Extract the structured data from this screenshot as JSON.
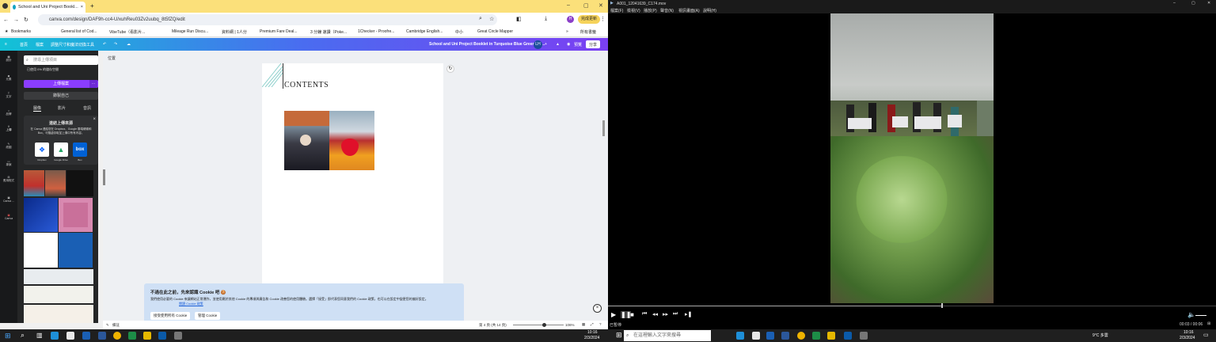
{
  "browser": {
    "tab_title": "School and Uni Project Bookl...",
    "url": "canva.com/design/DAF9h-cc4-U/xuhReu03Zv2uubq_8t5fZQ/edit",
    "update_button": "完成更新",
    "bookmarks_label": "Bookmarks",
    "all_bookmarks": "所有書籤",
    "bookmarks": [
      "General list of Cod...",
      "VibeTube（看影片...",
      "Mileage Run Discu...",
      "資料網 | 1人分",
      "Premium Fare Deal...",
      "3 分鐘 速讀（Poke...",
      "1Checker - Proofre...",
      "Cambridge English...",
      "中小",
      "Great Circle Mapper"
    ],
    "profile_initial": "H"
  },
  "canva": {
    "home": "首頁",
    "file": "檔案",
    "resize": "調整尺寸和魔法切換工具",
    "doc_title": "School and Uni Project Booklet in Turquoise Blue Green Viv...",
    "avatar": "LH",
    "preview": "預覽",
    "share": "分享",
    "position": "位置",
    "rail": [
      "設計",
      "元素",
      "文字",
      "品牌",
      "上傳",
      "繪圖",
      "專案",
      "應用程式",
      "Canva ...",
      "Canva"
    ],
    "search_placeholder": "搜尋上傳項目",
    "storage_text": "已使用 0% 的儲存空間",
    "upload_button": "上傳檔案",
    "record_button": "錄製自己",
    "panel_tabs": [
      "圖像",
      "影片",
      "音訊"
    ],
    "connect_title": "連結上傳來源",
    "connect_desc": "在 Canva 連結您在 Dropbox、Google 雲端硬碟和 Box，可隨處存取並上傳中所有內容。",
    "sources": [
      "Dropbox",
      "Google Drive",
      "Box"
    ],
    "page_heading": "CONTENTS",
    "page_indicator": "第 4 頁 (共 14 頁)",
    "zoom": "106%",
    "notes": "備註"
  },
  "cookie": {
    "title": "不過在此之前，先來認識 Cookie 吧 🍪",
    "body": "我們使用必要的 Cookie 來讓網站正常運作，並使用屬於其他 Cookie 的專項與廣告和 Cookie 改善您的使用體驗。選擇「接受」即代表您同意我們的 Cookie 政策，也可以在設定中變更您的偏好設定。",
    "link": "閱讀 Cookie 政策",
    "accept": "接受使用所有 Cookie",
    "manage": "管理 Cookie"
  },
  "player": {
    "title": "A001_12041639_C174.mov",
    "menu": [
      "檔案(F)",
      "檢視(V)",
      "播放(P)",
      "聲音(N)",
      "視訊畫面(A)",
      "說明(H)"
    ],
    "status": "已暫停",
    "time": "00:03 / 00:06",
    "progress": 0.55
  },
  "taskbar": {
    "search_placeholder": "在這裡輸入文字來搜尋",
    "time_left": "10:16",
    "date_left": "2/3/2024",
    "weather": "9°C 多雲",
    "time_right": "10:16",
    "date_right": "2/3/2024"
  },
  "colors": {
    "accent": "#7d2ae8",
    "chrome": "#fbe07a"
  }
}
